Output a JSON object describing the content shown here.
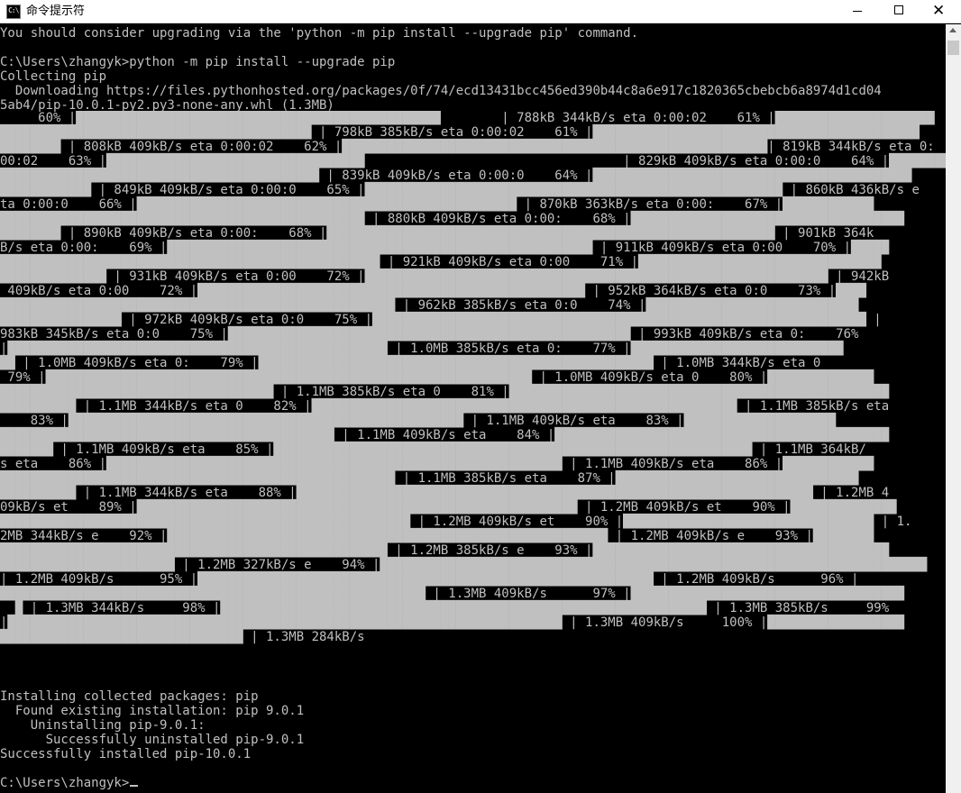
{
  "window": {
    "title": "命令提示符",
    "icon_text": "C:\\",
    "icon": "console-window-icon",
    "controls": {
      "minimize_icon": "minimize-icon",
      "maximize_icon": "maximize-icon",
      "close_icon": "close-icon"
    }
  },
  "colors": {
    "background": "#000000",
    "text": "#c0c0c0",
    "warning": "#c8b028",
    "titlebar": "#ffffff"
  },
  "console": {
    "warning": "You should consider upgrading via the 'python -m pip install --upgrade pip' command.",
    "command": "C:\\Users\\zhangyk>python -m pip install --upgrade pip",
    "collecting": "Collecting pip",
    "downloading_1": "  Downloading https://files.pythonhosted.org/packages/0f/74/ecd13431bcc456ed390b44c8a6e917c1820365cbebcb6a8974d1cd04",
    "downloading_2": "5ab4/pip-10.0.1-py2.py3-none-any.whl (1.3MB)",
    "progress_output": "     60% |████████████████████████████████████████████████        | 788kB 344kB/s eta 0:00:02    61% |█████████████████████\n█████████████████████████████████████████ | 798kB 385kB/s eta 0:00:02    61% |███████████████████████████████████████████\n████████ | 808kB 409kB/s eta 0:00:02    62% |████████████████████████████████████████████████████████| 819kB 344kB/s eta 0:\n00:02    63% |██████████████████████████████████                                  | 829kB 409kB/s eta 0:00:0    64% |██████████\n██████████████████████████████████████████ | 839kB 409kB/s eta 0:00:0    64% |██████████████████████████████████████████\n████████████ | 849kB 409kB/s eta 0:00:0    65% |███████████████████████████████████████████████████████ | 860kB 436kB/s e\nta 0:00:0    66% |██████████████████████████████████████████████████ | 870kB 363kB/s eta 0:00:    67% |████████████\n████████████████████████████████████████████████ | 880kB 409kB/s eta 0:00:    68% |████████████████████████████████████\n████████ | 890kB 409kB/s eta 0:00:    68% |███████████████████████████████████████████████████████████ | 901kB 364k\nB/s eta 0:00:    69% |████████████████████████████████████████████████████████ | 911kB 409kB/s eta 0:00    70% |█████\n██████████████████████████████████████████████████ | 921kB 409kB/s eta 0:00    71% |████████████████████████████████\n██████████████ | 931kB 409kB/s eta 0:00    72% |█████████████████████████████████████████████████████████████ | 942kB\n 409kB/s eta 0:00    72% |███████████████████████████████████████████████████ | 952kB 364kB/s eta 0:0    73% |████\n████████████████████████████████████████████████████ | 962kB 385kB/s eta 0:0    74% |████████████████████████████\n████████████████ | 972kB 409kB/s eta 0:0    75% |█████████████████████████████████████████████████████████████████ |\n983kB 345kB/s eta 0:0    75% |█████████████████████████████████████████████████████ | 993kB 409kB/s eta 0:    76%\n|██████████████████████████████████████████████████ | 1.0MB 385kB/s eta 0:    77% |████████████████████████████\n██ | 1.0MB 409kB/s eta 0:    79% |████████████████████████████████████████████████████ | 1.0MB 344kB/s eta 0\n 79% |████████████████████████████████████████████████████████████████ | 1.0MB 409kB/s eta 0    80% |██████████████\n████████████████████████████████████ | 1.1MB 385kB/s eta 0    81% |██████████████████████████████████████████████████\n██████████ | 1.1MB 344kB/s eta 0    82% |████████████████████████████████████████████████████████ | 1.1MB 385kB/s eta\n    83% |████████████████████████████████████████████████████ | 1.1MB 409kB/s eta    83% |████████████████████\n████████████████████████████████████████████ | 1.1MB 409kB/s eta    84% |████████████████████████████████████████████\n███████ | 1.1MB 409kB/s eta    85% |███████████████████████████████████████████████████████████████ | 1.1MB 364kB/\ns eta    86% |████████████████████████████████████████████████████████████ | 1.1MB 409kB/s eta    86% |████████████\n████████████████████████████████████████████████████ | 1.1MB 385kB/s eta    87% |████████████████████████████████\n██████████ | 1.1MB 344kB/s eta    88% |████████████████████████████████████████████████████████████████████ | 1.2MB 4\n09kB/s et    89% |██████████████████████████████████████████████████████████ | 1.2MB 409kB/s et    90% |██████████████\n██████████████████████████████████████████████████████ | 1.2MB 409kB/s et    90% |█████████████████████████████████ | 1.\n2MB 344kB/s e    92% |██████████████████████████████████████████████████████████ | 1.2MB 409kB/s e    93% |████████\n███████████████████████████████████████████████████ | 1.2MB 385kB/s e    93% |███████████████████████████████████████\n███████████████████████ | 1.2MB 327kB/s e    94% |████████████████████████████████████████████████████████████████████████\n| 1.2MB 409kB/s      95% |████████████████████████████████████████████████████████████ | 1.2MB 409kB/s      96% |\n████████████████████████████████████████████████████████ | 1.3MB 409kB/s      97% |████████████████████████████████████\n  █ | 1.3MB 344kB/s     98% |████████████████████████████████████████████████████████████████ | 1.3MB 385kB/s     99%\n|█████████████████████████████████████████████████████████████████████████ | 1.3MB 409kB/s     100% |██████████████████\n████████████████████████████████ | 1.3MB 284kB/s",
    "installing": "Installing collected packages: pip\n  Found existing installation: pip 9.0.1\n    Uninstalling pip-9.0.1:\n      Successfully uninstalled pip-9.0.1\nSuccessfully installed pip-10.0.1",
    "prompt": "C:\\Users\\zhangyk>"
  },
  "scrollbar": {
    "up_arrow_icon": "scroll-up-arrow-icon"
  }
}
